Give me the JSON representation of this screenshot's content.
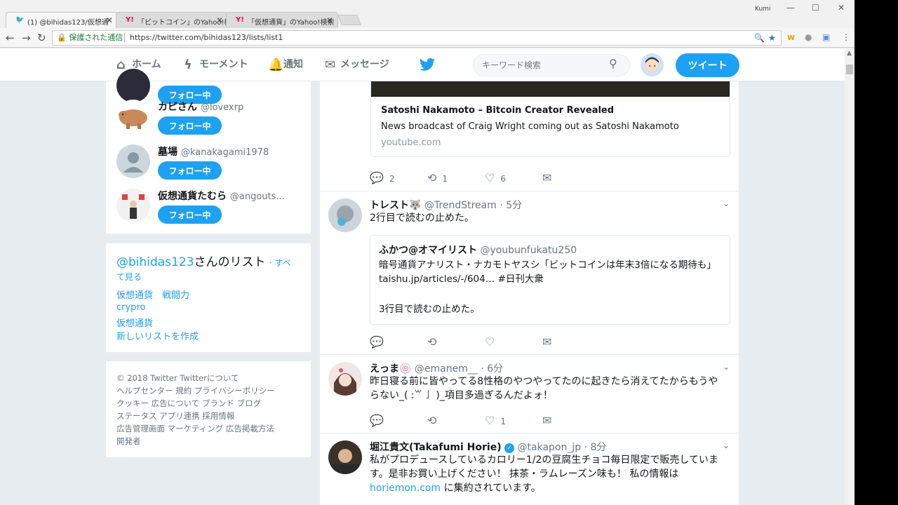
{
  "browser": {
    "tabs": [
      {
        "title": "(1) @bihidas123/仮想通",
        "icon": "twitter-bird"
      },
      {
        "title": "「ビットコイン」のYahoo!検索",
        "icon": "yahoo"
      },
      {
        "title": "「仮想通貨」のYahoo!検索",
        "icon": "yahoo"
      }
    ],
    "user_label": "Kumi",
    "secure_label": "保護された通信",
    "url": "https://twitter.com/bihidas123/lists/list1"
  },
  "nav": {
    "home": "ホーム",
    "moments": "モーメント",
    "notifications": "通知",
    "messages": "メッセージ",
    "search_placeholder": "キーワード検索",
    "tweet_button": "ツイート"
  },
  "sidebar": {
    "follow_partial": "フォロー中",
    "who": [
      {
        "name": "カピさん",
        "handle": "@lovexrp",
        "button": "フォロー中"
      },
      {
        "name": "墓場",
        "handle": "@kanakagami1978",
        "button": "フォロー中"
      },
      {
        "name": "仮想通貨たむら",
        "handle": "@angouts...",
        "button": "フォロー中"
      }
    ],
    "lists_title_handle": "@bihidas123",
    "lists_title_suffix": "さんのリスト",
    "lists_see_all": "· すべて見る",
    "lists": [
      "仮想通貨　戦闘力",
      "crypro",
      "仮想通貨",
      "新しいリストを作成"
    ],
    "footer": [
      "© 2018 Twitter  Twitterについて",
      "ヘルプセンター  規約  プライバシーポリシー",
      "クッキー  広告について  ブランド  ブログ",
      "ステータス  アプリ連携  採用情報",
      "広告管理画面  マーケティング  広告掲載方法",
      "開発者"
    ]
  },
  "timeline": {
    "card1": {
      "title": "Satoshi Nakamoto – Bitcoin Creator Revealed",
      "desc": "News broadcast of Craig Wright coming out as Satoshi Nakamoto",
      "domain": "youtube.com",
      "replies": "2",
      "retweets": "1",
      "likes": "6"
    },
    "tweets": [
      {
        "name": "トレスト🐺",
        "handle": "@TrendStream",
        "time": "· 5分",
        "text": "2行目で読むの止めた。",
        "quote_name": "ふかつ@オマイリスト",
        "quote_handle": "@youbunfukatu250",
        "quote_text1": "暗号通貨アナリスト・ナカモトヤスシ「ビットコインは年末3倍になる期待も」 taishu.jp/articles/-/604… #日刊大衆",
        "quote_text2": "3行目で読むの止めた。"
      },
      {
        "name": "えっま🍥",
        "handle": "@emanem__",
        "time": "· 6分",
        "text": "昨日寝る前に皆やってる8性格のやつやってたのに起きたら消えてたからもうやらない_( :꒳ 」 )_項目多過ぎるんだよォ！",
        "likes": "1"
      },
      {
        "name": "堀江貴文(Takafumi Horie)",
        "handle": "@takapon_jp",
        "time": "· 8分",
        "text": "私がプロデュースしているカロリー1/2の豆腐生チョコ毎日限定で販売しています。是非お買い上げください！ 抹茶・ラムレーズン味も！ 私の情報は",
        "link": "horiemon.com",
        "text_end": " に集約されています。"
      }
    ]
  },
  "colors": {
    "accent": "#1da1f2",
    "bg": "#e6ecf0",
    "text": "#14171a",
    "muted": "#657786"
  }
}
